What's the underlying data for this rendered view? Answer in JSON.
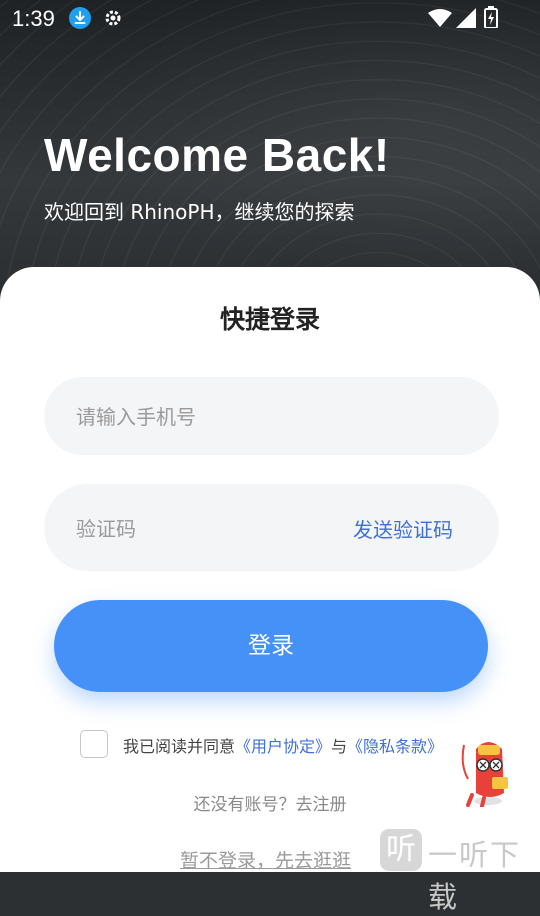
{
  "status_bar": {
    "time": "1:39"
  },
  "header": {
    "title": "Welcome Back!",
    "subtitle": "欢迎回到 RhinoPH，继续您的探索"
  },
  "login": {
    "title": "快捷登录",
    "phone_placeholder": "请输入手机号",
    "code_placeholder": "验证码",
    "send_code_label": "发送验证码",
    "login_button": "登录"
  },
  "agreement": {
    "prefix": "我已阅读并同意",
    "user_agreement": "《用户协定》",
    "conjunction": "与",
    "privacy_policy": "《隐私条款》",
    "checked": false
  },
  "register_text": "还没有账号？去注册",
  "skip_text": "暂不登录，先去逛逛",
  "watermark": {
    "icon_text": "听",
    "text": "一听下载"
  },
  "colors": {
    "accent": "#4591f7",
    "link": "#3f6fd8",
    "header_bg": "#2d3033"
  }
}
